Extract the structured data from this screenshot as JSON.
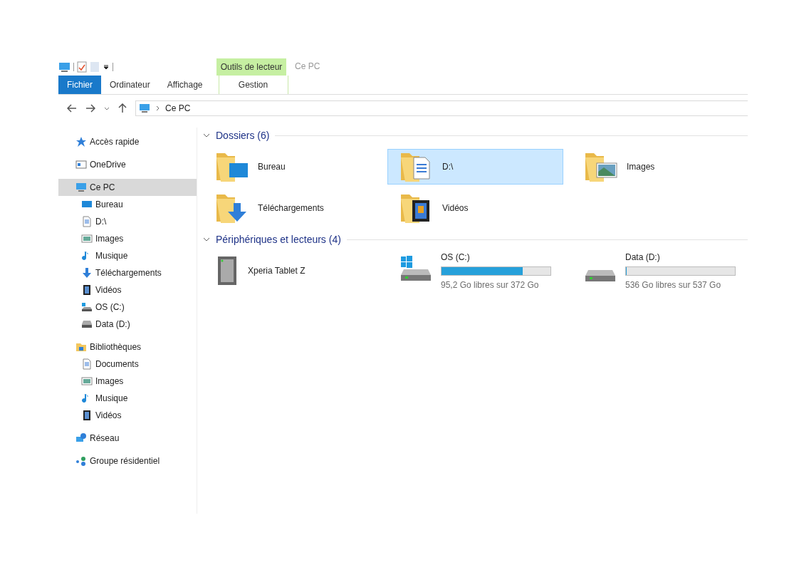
{
  "window": {
    "title": "Ce PC"
  },
  "ribbon": {
    "context_group": "Outils de lecteur",
    "tabs": [
      {
        "label": "Fichier",
        "selected": false,
        "kind": "file"
      },
      {
        "label": "Ordinateur",
        "selected": false,
        "kind": "normal"
      },
      {
        "label": "Affichage",
        "selected": false,
        "kind": "normal"
      },
      {
        "label": "Gestion",
        "selected": false,
        "kind": "context"
      }
    ]
  },
  "address_bar": {
    "path": "Ce PC"
  },
  "sidebar": {
    "items": [
      {
        "label": "Accès rapide",
        "selected": false
      },
      {
        "label": "OneDrive",
        "selected": false
      },
      {
        "label": "Ce PC",
        "selected": true,
        "children": [
          {
            "label": "Bureau",
            "selected": false
          },
          {
            "label": "D:\\",
            "selected": false
          },
          {
            "label": "Images",
            "selected": false
          },
          {
            "label": "Musique",
            "selected": false
          },
          {
            "label": "Téléchargements",
            "selected": false
          },
          {
            "label": "Vidéos",
            "selected": false
          },
          {
            "label": "OS (C:)",
            "selected": false
          },
          {
            "label": "Data (D:)",
            "selected": false
          }
        ]
      },
      {
        "label": "Bibliothèques",
        "selected": false,
        "children": [
          {
            "label": "Documents",
            "selected": false
          },
          {
            "label": "Images",
            "selected": false
          },
          {
            "label": "Musique",
            "selected": false
          },
          {
            "label": "Vidéos",
            "selected": false
          }
        ]
      },
      {
        "label": "Réseau",
        "selected": false
      },
      {
        "label": "Groupe résidentiel",
        "selected": false
      }
    ]
  },
  "groups": [
    {
      "title": "Dossiers (6)",
      "kind": "folders",
      "items": [
        {
          "name": "Bureau",
          "selected": false
        },
        {
          "name": "D:\\",
          "selected": true
        },
        {
          "name": "Images",
          "selected": false
        },
        {
          "name": "Téléchargements",
          "selected": false
        },
        {
          "name": "Vidéos",
          "selected": false
        }
      ]
    },
    {
      "title": "Périphériques et lecteurs (4)",
      "kind": "devices",
      "items": [
        {
          "name": "Xperia Tablet Z",
          "kind": "device",
          "selected": false
        },
        {
          "name": "OS (C:)",
          "kind": "drive",
          "level": 0.744,
          "free": "95,2 Go libres sur 372 Go",
          "selected": false
        },
        {
          "name": "Data (D:)",
          "kind": "drive",
          "level": 0.002,
          "free": "536 Go libres sur 537 Go",
          "selected": false
        }
      ]
    }
  ]
}
